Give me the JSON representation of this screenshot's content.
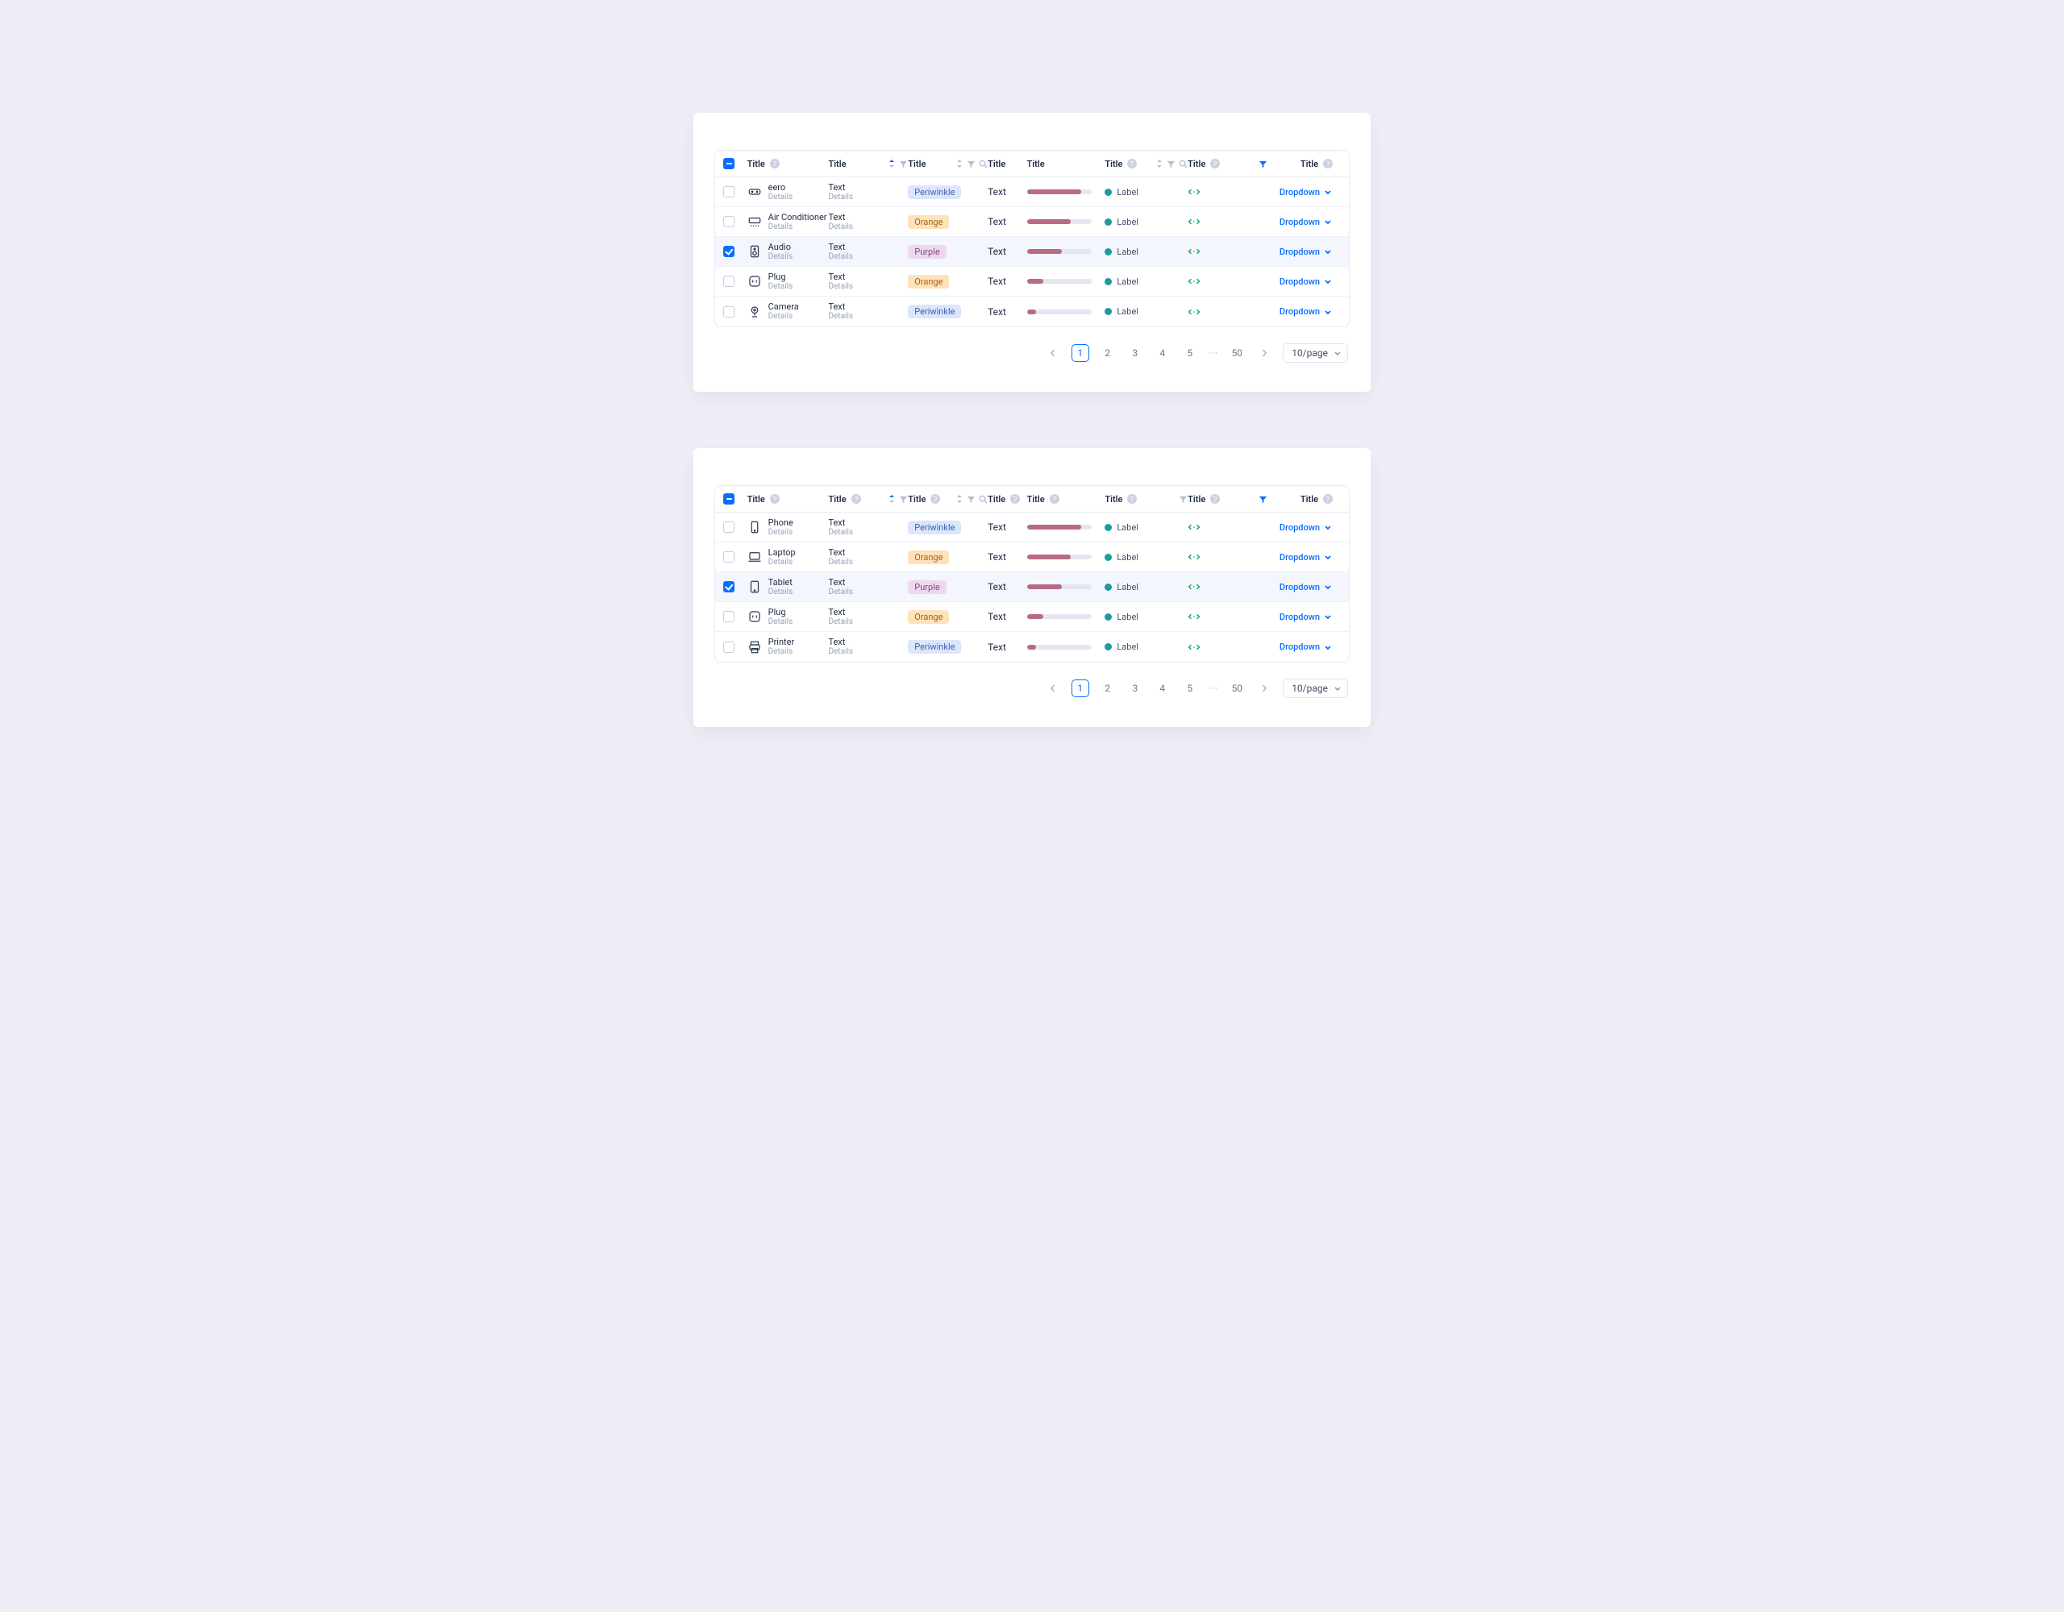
{
  "shared": {
    "header_title": "Title",
    "details": "Details",
    "text": "Text",
    "label": "Label",
    "dropdown": "Dropdown",
    "page_size": "10/page"
  },
  "pagination": {
    "pages": [
      "1",
      "2",
      "3",
      "4",
      "5",
      "…",
      "50"
    ],
    "current": "1"
  },
  "table1": {
    "rows": [
      {
        "icon": "router",
        "name": "eero",
        "badge": "Periwinkle",
        "badgeCls": "periwinkle",
        "progress": 84,
        "checked": false
      },
      {
        "icon": "ac",
        "name": "Air Conditioner",
        "badge": "Orange",
        "badgeCls": "orange",
        "progress": 68,
        "checked": false
      },
      {
        "icon": "speaker",
        "name": "Audio",
        "badge": "Purple",
        "badgeCls": "purple",
        "progress": 54,
        "checked": true
      },
      {
        "icon": "plug",
        "name": "Plug",
        "badge": "Orange",
        "badgeCls": "orange",
        "progress": 26,
        "checked": false
      },
      {
        "icon": "camera",
        "name": "Camera",
        "badge": "Periwinkle",
        "badgeCls": "periwinkle",
        "progress": 14,
        "checked": false
      }
    ]
  },
  "table2": {
    "rows": [
      {
        "icon": "phone",
        "name": "Phone",
        "badge": "Periwinkle",
        "badgeCls": "periwinkle",
        "progress": 84,
        "checked": false
      },
      {
        "icon": "laptop",
        "name": "Laptop",
        "badge": "Orange",
        "badgeCls": "orange",
        "progress": 68,
        "checked": false
      },
      {
        "icon": "tablet",
        "name": "Tablet",
        "badge": "Purple",
        "badgeCls": "purple",
        "progress": 54,
        "checked": true
      },
      {
        "icon": "plug",
        "name": "Plug",
        "badge": "Orange",
        "badgeCls": "orange",
        "progress": 26,
        "checked": false
      },
      {
        "icon": "printer",
        "name": "Printer",
        "badge": "Periwinkle",
        "badgeCls": "periwinkle",
        "progress": 14,
        "checked": false
      }
    ]
  }
}
